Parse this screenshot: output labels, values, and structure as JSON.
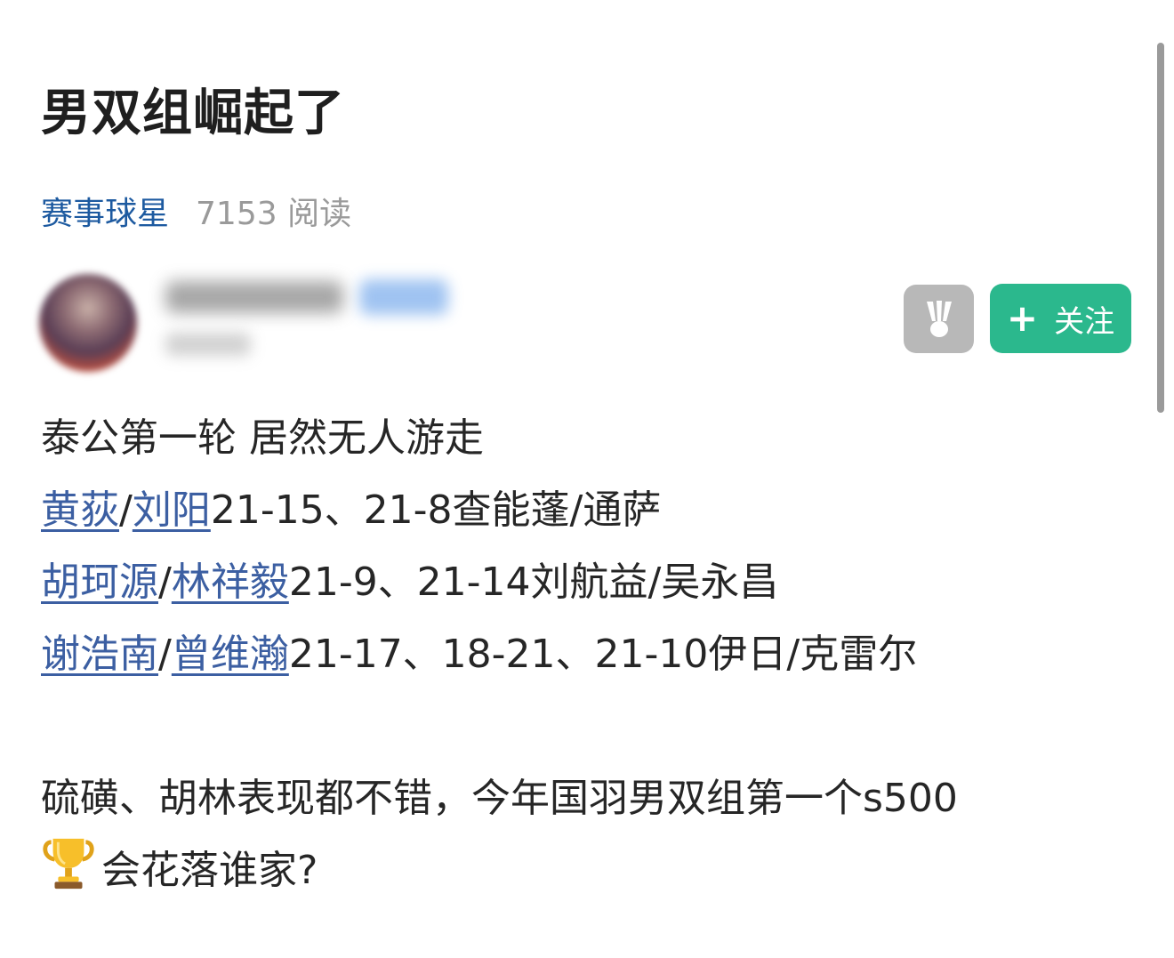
{
  "post": {
    "title": "男双组崛起了",
    "category": "赛事球星",
    "reads": "7153 阅读"
  },
  "author": {
    "follow_plus": "+",
    "follow_label": "关注"
  },
  "content": {
    "line1": "泰公第一轮 居然无人游走",
    "results": [
      {
        "p1": "黄荻",
        "sep": "/",
        "p2": "刘阳",
        "rest": "21-15、21-8查能蓬/通萨"
      },
      {
        "p1": "胡珂源",
        "sep": "/",
        "p2": "林祥毅",
        "rest": "21-9、21-14刘航益/吴永昌"
      },
      {
        "p1": "谢浩南",
        "sep": "/",
        "p2": "曾维瀚",
        "rest": "21-17、18-21、21-10伊日/克雷尔"
      }
    ],
    "para2_line1": "硫磺、胡林表现都不错，今年国羽男双组第一个s500",
    "para2_line2": "会花落谁家?"
  },
  "colors": {
    "link": "#3c5fa2",
    "category": "#1d5aa0",
    "follow_bg": "#2bb88d",
    "icon_btn_bg": "#b8b8b8"
  },
  "icons": [
    "shuttlecock-icon",
    "trophy-icon"
  ]
}
